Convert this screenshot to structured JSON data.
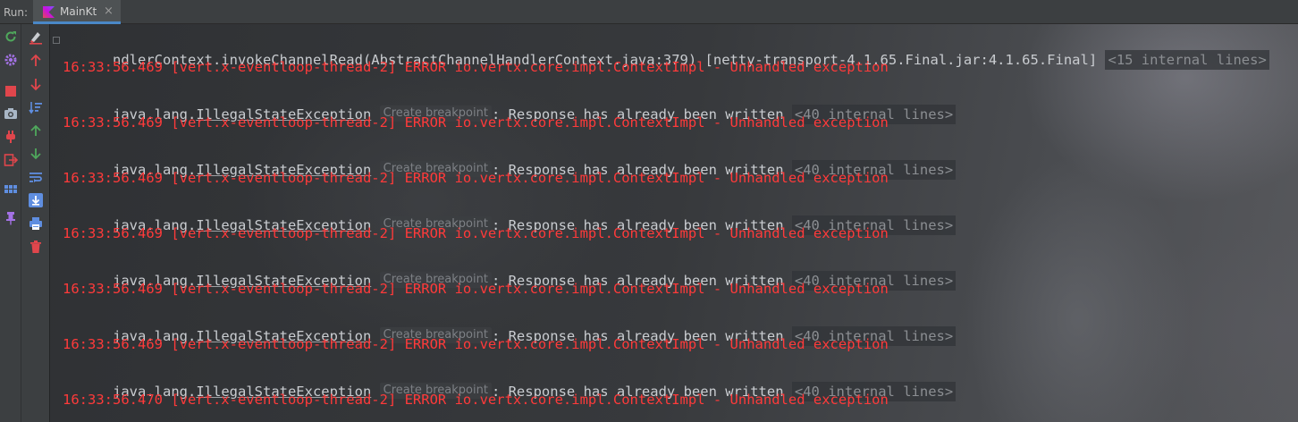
{
  "run": {
    "label": "Run:",
    "tab_label": "MainKt",
    "tab_close": "×"
  },
  "colors": {
    "error": "#ff3a3a",
    "text": "#c9ccd0",
    "accent": "#4a88c7"
  },
  "toolbar_left": [
    {
      "name": "rerun-icon",
      "color": "#4fa85c"
    },
    {
      "name": "settings-icon",
      "color": "#a472e6"
    },
    {
      "name": "stop-icon",
      "color": "#e0464c"
    },
    {
      "name": "camera-icon",
      "color": "#a9b7c6"
    },
    {
      "name": "plug-icon",
      "color": "#e0464c"
    },
    {
      "name": "exit-icon",
      "color": "#e0464c"
    },
    {
      "name": "layout-icon",
      "color": "#5f8ee0"
    },
    {
      "name": "pin-icon",
      "color": "#a472e6"
    }
  ],
  "toolbar_right": [
    {
      "name": "clear-icon",
      "color": "#e0464c"
    },
    {
      "name": "up-arrow-icon",
      "color": "#e0464c"
    },
    {
      "name": "down-arrow-icon",
      "color": "#e0464c"
    },
    {
      "name": "sort-icon",
      "color": "#5f8ee0"
    },
    {
      "name": "scroll-up-icon",
      "color": "#4fa85c"
    },
    {
      "name": "scroll-down-icon",
      "color": "#4fa85c"
    },
    {
      "name": "soft-wrap-icon",
      "color": "#5f8ee0"
    },
    {
      "name": "scroll-to-end-icon",
      "color": "#5f8ee0"
    },
    {
      "name": "print-icon",
      "color": "#5f8ee0"
    },
    {
      "name": "delete-icon",
      "color": "#e0464c"
    }
  ],
  "console": {
    "first_line": {
      "text": "ndlerContext.invokeChannelRead(AbstractChannelHandlerContext.java:379) [netty-transport-4.1.65.Final.jar:4.1.65.Final] ",
      "folded": "<15 internal lines>"
    },
    "error_lines": [
      "16:33:56.469 [vert.x-eventloop-thread-2] ERROR io.vertx.core.impl.ContextImpl - Unhandled exception",
      "16:33:56.469 [vert.x-eventloop-thread-2] ERROR io.vertx.core.impl.ContextImpl - Unhandled exception",
      "16:33:56.469 [vert.x-eventloop-thread-2] ERROR io.vertx.core.impl.ContextImpl - Unhandled exception",
      "16:33:56.469 [vert.x-eventloop-thread-2] ERROR io.vertx.core.impl.ContextImpl - Unhandled exception",
      "16:33:56.469 [vert.x-eventloop-thread-2] ERROR io.vertx.core.impl.ContextImpl - Unhandled exception",
      "16:33:56.469 [vert.x-eventloop-thread-2] ERROR io.vertx.core.impl.ContextImpl - Unhandled exception",
      "16:33:56.470 [vert.x-eventloop-thread-2] ERROR io.vertx.core.impl.ContextImpl - Unhandled exception"
    ],
    "exception": {
      "prefix": "java.lang.",
      "class": "IllegalStateException",
      "hint": "Create breakpoint",
      "message": ": Response has already been written ",
      "folded": "<40 internal lines>"
    }
  }
}
